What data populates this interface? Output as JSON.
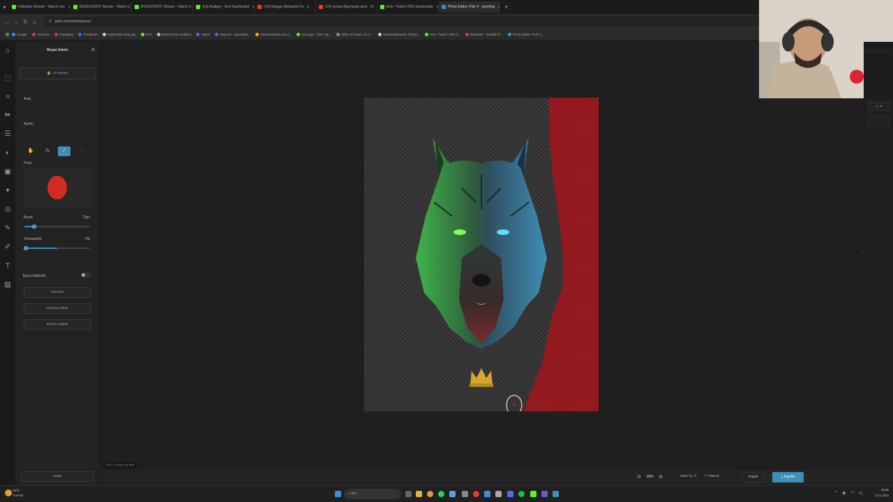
{
  "browser": {
    "tabs": [
      {
        "label": "Palladine Stream - Watch Live",
        "color": "#53fc18"
      },
      {
        "label": "BOZDOGRTF Stream - Watch Li",
        "color": "#53fc18"
      },
      {
        "label": "BOZDOGRTF Stream - Watch Li",
        "color": "#53fc18"
      },
      {
        "label": "Sub Badges - Kick Dashboard",
        "color": "#53fc18"
      },
      {
        "label": "(14) Shaggy Mohawnk Fu",
        "color": "#e53935"
      },
      {
        "label": "(14) yomas dkg/nypaz pool - Yo",
        "color": "#e53935"
      },
      {
        "label": "Kick / Twitch VOD downloader",
        "color": "#53fc18"
      },
      {
        "label": "Photo Editor: Pixlr X - greeting",
        "color": "#3c8fb7"
      }
    ],
    "url": "pixlr.com/x/#express/",
    "bookmarks": [
      {
        "label": "Google",
        "color": "#4285f4"
      },
      {
        "label": "YouTube",
        "color": "#e53935"
      },
      {
        "label": "Instagram",
        "color": "#c13584"
      },
      {
        "label": "Facebook",
        "color": "#1877f2"
      },
      {
        "label": "Twitter'dan Giriş yap",
        "color": "#cccccc"
      },
      {
        "label": "Kick",
        "color": "#53fc18"
      },
      {
        "label": "Resmin Boy Geldirici",
        "color": "#bbbbbb"
      },
      {
        "label": "Twitch",
        "color": "#9146ff"
      },
      {
        "label": "Discord - Oyunlarla...",
        "color": "#5865f2"
      },
      {
        "label": "StreamerStats.com |...",
        "color": "#f4b400"
      },
      {
        "label": "Kick.app - Kick Yay...",
        "color": "#53fc18"
      },
      {
        "label": "EDM_E-Fatura, E-Ar...",
        "color": "#888888"
      },
      {
        "label": "StreamElements Türkçe...",
        "color": "#cccccc"
      },
      {
        "label": "Kick / Twitch VOD d...",
        "color": "#53fc18"
      },
      {
        "label": "Bauhutte - Güzelik Ö...",
        "color": "#e53935"
      },
      {
        "label": "Photo Editor: Pixlr X...",
        "color": "#3c8fb7"
      }
    ]
  },
  "panel": {
    "title": "Beyaz Zemin",
    "ai_button": "AI Kesme",
    "tool_label": "Araç",
    "action_label": "Ayılım",
    "action_options": [
      "SAKLA",
      "KAZIM"
    ],
    "brush_label": "Fırça",
    "size_label": "Boyut",
    "size_value": "73px",
    "size_fraction": 0.15,
    "soft_label": "Yumuşaklık",
    "soft_value": "0%",
    "soft_fraction": 0.5,
    "hint_label": "İpucu kaldırıldı",
    "buttons": [
      "Tüm kes",
      "Kesmeyi sıfırla",
      "Kesme uygula"
    ],
    "close_button": "Kapat"
  },
  "canvas": {
    "dims_label": "1024 x 1024 px @ 88%"
  },
  "bottombar": {
    "zoom": "88%",
    "undo": "GERİ AL",
    "redo": "YİNELE",
    "close": "Kapat",
    "save": "Kaydet"
  },
  "taskbar": {
    "weather_temp": "14°C",
    "weather_text": "Güneşli",
    "search_placeholder": "Ara",
    "time": "15:31",
    "date": "14.11.2024"
  },
  "colors": {
    "accent": "#3c8fb7",
    "brush": "#d32a22",
    "overlay_red": "#9b1c22"
  }
}
